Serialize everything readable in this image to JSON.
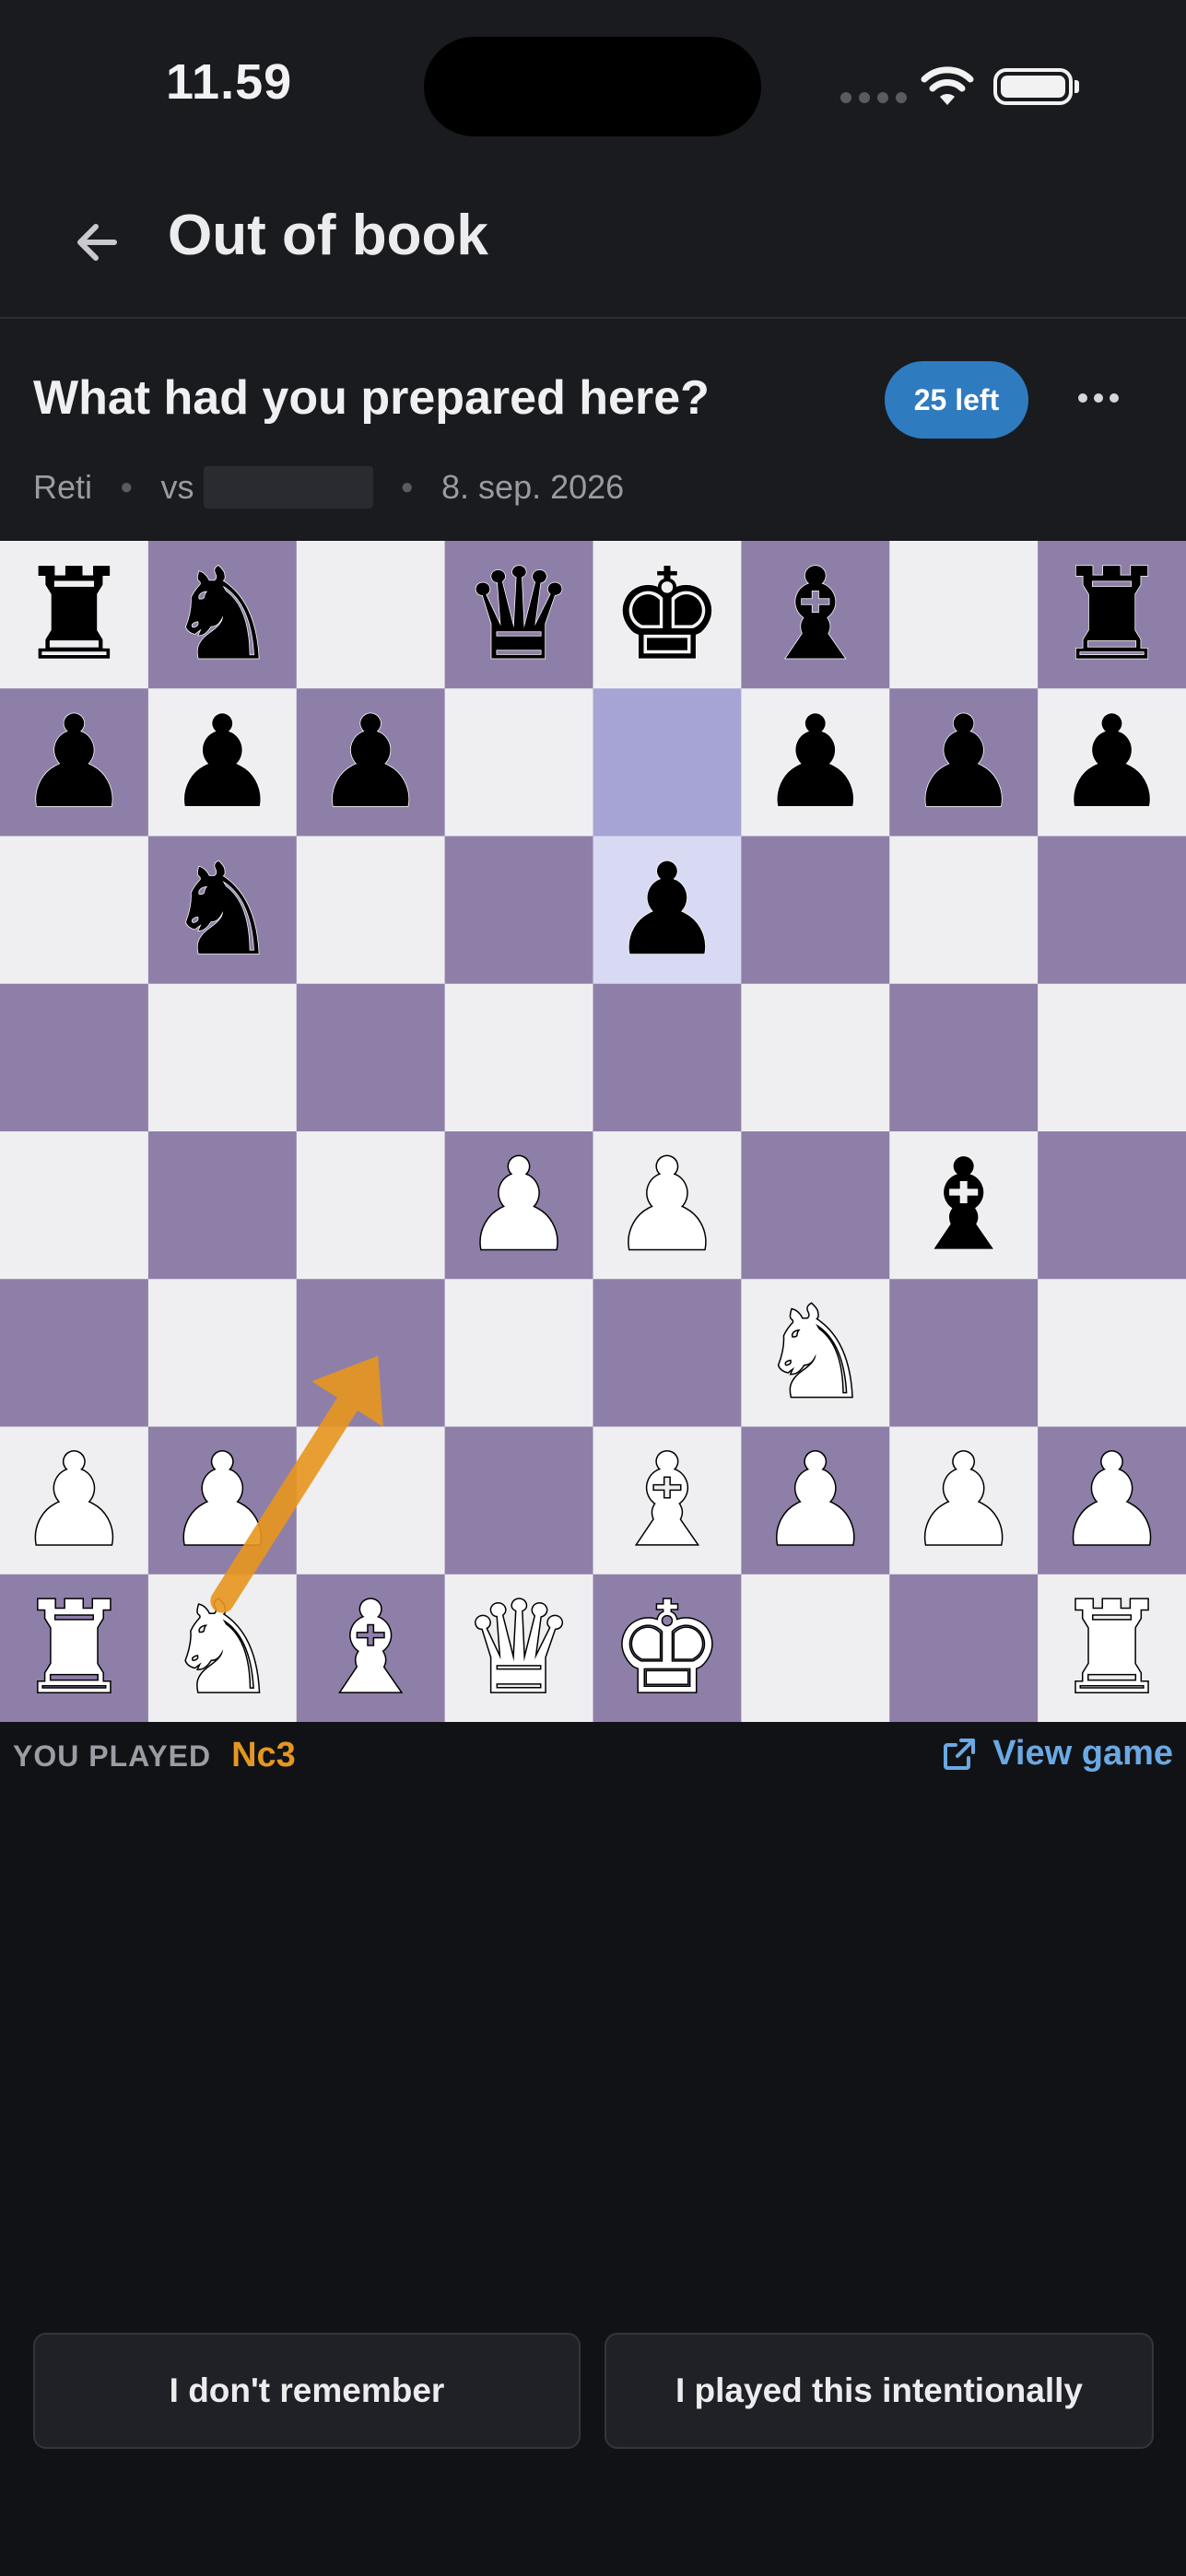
{
  "status_bar": {
    "time": "11.59"
  },
  "app_bar": {
    "title": "Out of book"
  },
  "prompt": {
    "question": "What had you prepared here?",
    "remaining_badge": "25 left",
    "opening": "Reti",
    "vs_label": "vs",
    "date": "8. sep. 2026"
  },
  "board": {
    "light_color": "#efeff2",
    "dark_color": "#8e7fa8",
    "highlight_light": "#d7daf2",
    "highlight_dark": "#a6a4d4",
    "arrow_color": "#e8961e",
    "highlight_squares": [
      "e7",
      "e6"
    ],
    "arrow": {
      "from": "b1",
      "to": "c3"
    },
    "pieces": [
      {
        "square": "a8",
        "piece": "r"
      },
      {
        "square": "b8",
        "piece": "n"
      },
      {
        "square": "d8",
        "piece": "q"
      },
      {
        "square": "e8",
        "piece": "k"
      },
      {
        "square": "f8",
        "piece": "b"
      },
      {
        "square": "h8",
        "piece": "r"
      },
      {
        "square": "a7",
        "piece": "p"
      },
      {
        "square": "b7",
        "piece": "p"
      },
      {
        "square": "c7",
        "piece": "p"
      },
      {
        "square": "f7",
        "piece": "p"
      },
      {
        "square": "g7",
        "piece": "p"
      },
      {
        "square": "h7",
        "piece": "p"
      },
      {
        "square": "b6",
        "piece": "n"
      },
      {
        "square": "e6",
        "piece": "p"
      },
      {
        "square": "d4",
        "piece": "P"
      },
      {
        "square": "e4",
        "piece": "P"
      },
      {
        "square": "g4",
        "piece": "b"
      },
      {
        "square": "f3",
        "piece": "N"
      },
      {
        "square": "a2",
        "piece": "P"
      },
      {
        "square": "b2",
        "piece": "P"
      },
      {
        "square": "e2",
        "piece": "B"
      },
      {
        "square": "f2",
        "piece": "P"
      },
      {
        "square": "g2",
        "piece": "P"
      },
      {
        "square": "h2",
        "piece": "P"
      },
      {
        "square": "a1",
        "piece": "R"
      },
      {
        "square": "b1",
        "piece": "N"
      },
      {
        "square": "c1",
        "piece": "B"
      },
      {
        "square": "d1",
        "piece": "Q"
      },
      {
        "square": "e1",
        "piece": "K"
      },
      {
        "square": "h1",
        "piece": "R"
      }
    ]
  },
  "result": {
    "you_played_label": "YOU PLAYED",
    "move": "Nc3",
    "view_game_label": "View game"
  },
  "actions": {
    "dont_remember": "I don't remember",
    "intentional": "I played this intentionally"
  }
}
